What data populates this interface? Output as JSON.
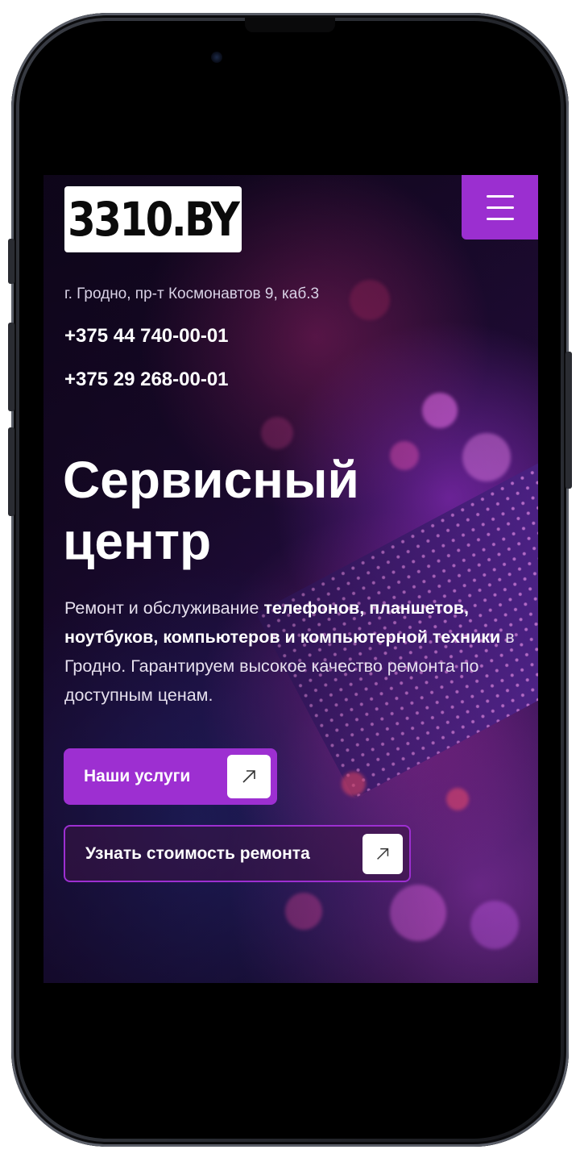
{
  "header": {
    "logo_text": "3310.BY",
    "menu_icon": "hamburger-icon"
  },
  "contacts": {
    "address": "г. Гродно, пр-т Космонавтов 9, каб.3",
    "phone_1": "+375 44 740-00-01",
    "phone_2": "+375 29 268-00-01"
  },
  "hero": {
    "title_line_1": "Сервисный",
    "title_line_2": "центр",
    "desc_part_1": "Ремонт и обслуживание ",
    "desc_bold": "телефонов, планшетов, ноутбуков, компьютеров и компьютерной техники",
    "desc_part_2": " в Гродно. Гарантируем высокое качество ремонта по доступным ценам."
  },
  "actions": {
    "services_label": "Наши услуги",
    "price_label": "Узнать стоимость ремонта",
    "arrow_icon": "arrow-up-right-icon"
  },
  "colors": {
    "accent": "#9d2fd1",
    "text": "#ffffff"
  }
}
